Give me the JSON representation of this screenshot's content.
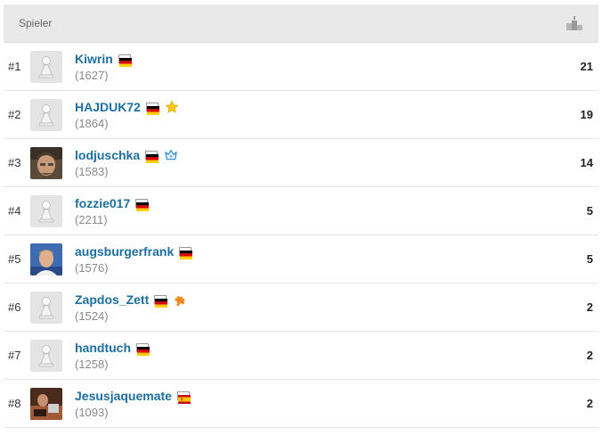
{
  "header": {
    "title": "Spieler",
    "icon": "podium-icon"
  },
  "colors": {
    "link": "#1c6fa0",
    "rating": "#8a8a8a",
    "header_bg": "#e9e9e9"
  },
  "players": [
    {
      "rank": "#1",
      "name": "Kiwrin",
      "rating": "(1627)",
      "score": "21",
      "flag": "de",
      "badge": "",
      "avatar": "pawn"
    },
    {
      "rank": "#2",
      "name": "HAJDUK72",
      "rating": "(1864)",
      "score": "19",
      "flag": "de",
      "badge": "star",
      "avatar": "pawn"
    },
    {
      "rank": "#3",
      "name": "lodjuschka",
      "rating": "(1583)",
      "score": "14",
      "flag": "de",
      "badge": "crown",
      "avatar": "photo"
    },
    {
      "rank": "#4",
      "name": "fozzie017",
      "rating": "(2211)",
      "score": "5",
      "flag": "de",
      "badge": "",
      "avatar": "pawn"
    },
    {
      "rank": "#5",
      "name": "augsburgerfrank",
      "rating": "(1576)",
      "score": "5",
      "flag": "de",
      "badge": "",
      "avatar": "photo"
    },
    {
      "rank": "#6",
      "name": "Zapdos_Zett",
      "rating": "(1524)",
      "score": "2",
      "flag": "de",
      "badge": "puzzle",
      "avatar": "pawn"
    },
    {
      "rank": "#7",
      "name": "handtuch",
      "rating": "(1258)",
      "score": "2",
      "flag": "de",
      "badge": "",
      "avatar": "pawn"
    },
    {
      "rank": "#8",
      "name": "Jesusjaquemate",
      "rating": "(1093)",
      "score": "2",
      "flag": "es",
      "badge": "",
      "avatar": "photo"
    }
  ]
}
